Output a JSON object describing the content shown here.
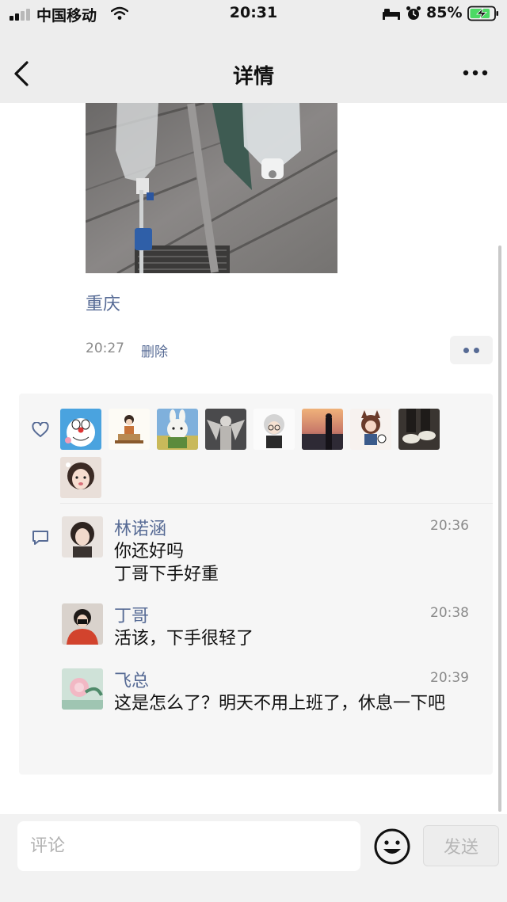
{
  "status_bar": {
    "carrier": "中国移动",
    "time": "20:31",
    "battery_percent": "85%",
    "battery_level": 0.85,
    "icons": [
      "signal-icon",
      "wifi-icon",
      "bed-icon",
      "alarm-icon",
      "battery-charging-icon"
    ]
  },
  "nav": {
    "title": "详情",
    "back_icon": "chevron-left-icon",
    "more_icon": "more-icon"
  },
  "post": {
    "location": "重庆",
    "time": "20:27",
    "delete_label": "删除",
    "menu_icon": "more-dots-icon"
  },
  "likes": {
    "icon": "heart-icon",
    "avatars": [
      "doraemon-avatar",
      "reading-girl-avatar",
      "bunny-avatar",
      "angel-statue-avatar",
      "white-hair-avatar",
      "sunset-avatar",
      "cat-girl-avatar",
      "sneakers-avatar",
      "girl-portrait-avatar"
    ]
  },
  "comments": {
    "icon": "comment-icon",
    "items": [
      {
        "name": "林诺涵",
        "time": "20:36",
        "text": "你还好吗\n丁哥下手好重"
      },
      {
        "name": "丁哥",
        "time": "20:38",
        "text": "活该，下手很轻了"
      },
      {
        "name": "飞总",
        "time": "20:39",
        "text": "这是怎么了？明天不用上班了，休息一下吧"
      }
    ]
  },
  "input_bar": {
    "placeholder": "评论",
    "emoji_icon": "emoji-icon",
    "send_label": "发送"
  },
  "colors": {
    "link": "#576b95",
    "nav_background": "#ededed",
    "panel_background": "#f6f6f6",
    "battery_green": "#4cd964"
  }
}
